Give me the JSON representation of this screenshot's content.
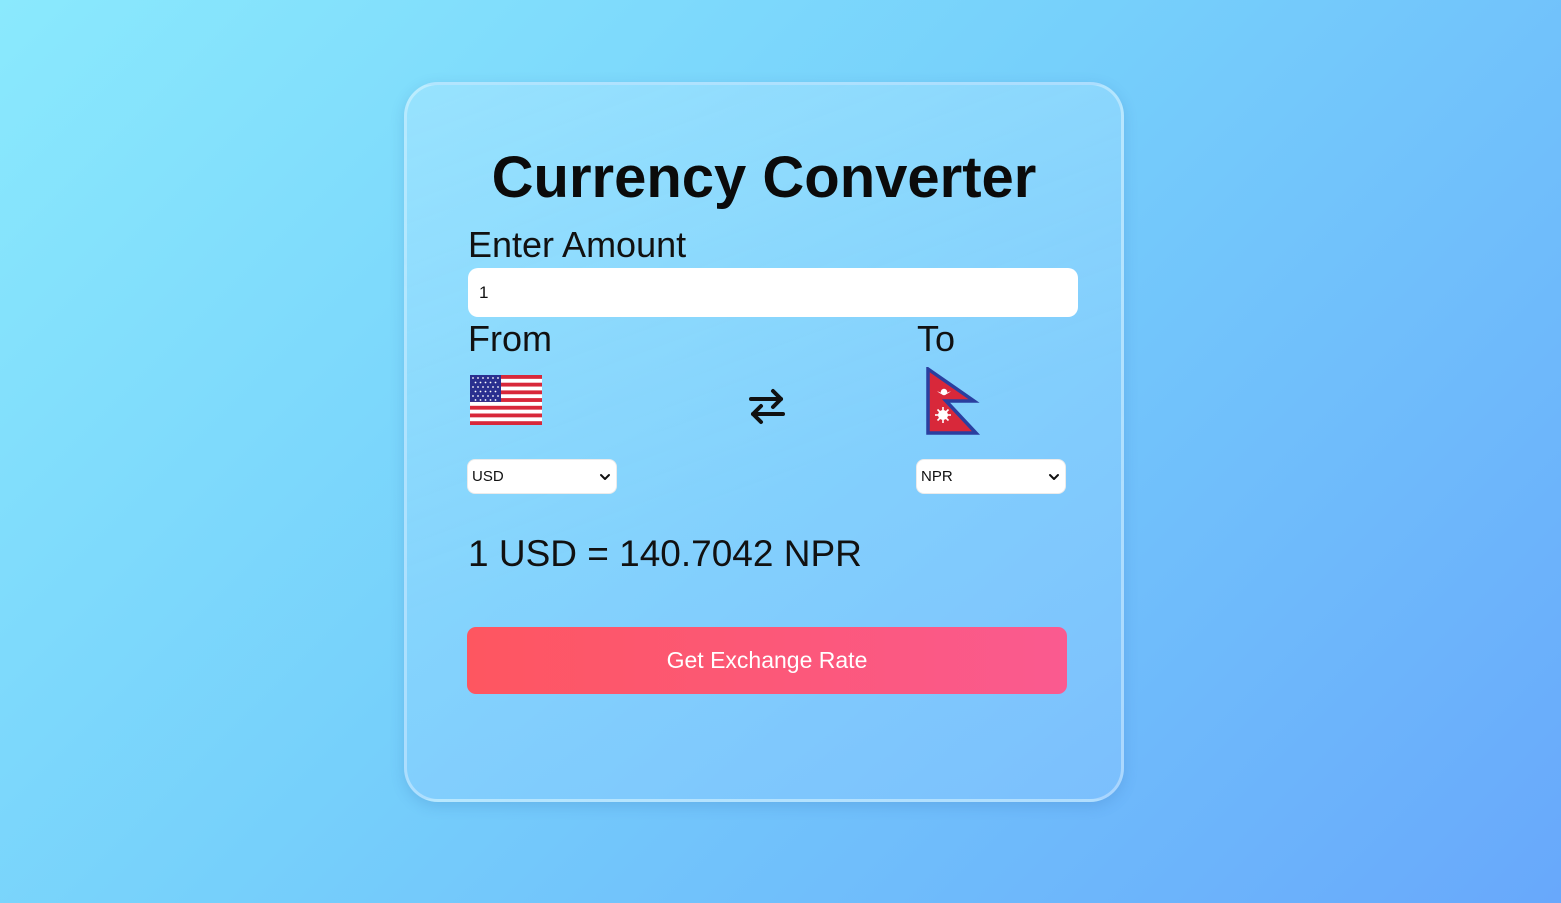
{
  "app": {
    "title": "Currency Converter"
  },
  "amount": {
    "label": "Enter Amount",
    "value": "1"
  },
  "from": {
    "label": "From",
    "currency": "USD",
    "flag_icon": "us-flag-icon"
  },
  "to": {
    "label": "To",
    "currency": "NPR",
    "flag_icon": "nepal-flag-icon"
  },
  "swap": {
    "icon": "swap-arrows-icon"
  },
  "result": {
    "text": "1 USD = 140.7042 NPR"
  },
  "action": {
    "button_label": "Get Exchange Rate"
  },
  "colors": {
    "button_start": "#fe5660",
    "button_end": "#fa5a90",
    "background_start": "#8ae9fd",
    "background_end": "#68a8fb"
  }
}
